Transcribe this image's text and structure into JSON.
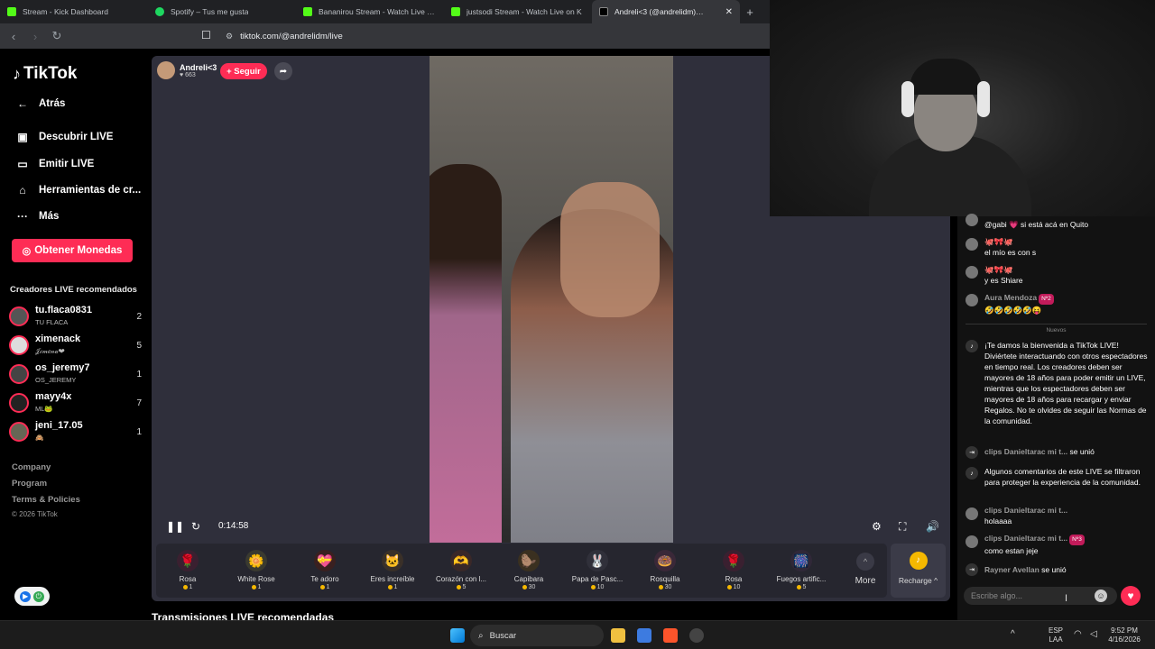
{
  "browser": {
    "tabs": [
      {
        "label": "Stream - Kick Dashboard",
        "color": "#53fc18"
      },
      {
        "label": "Spotify – Tus me gusta",
        "color": "#1ed760"
      },
      {
        "label": "Bananirou Stream - Watch Live on Ki",
        "color": "#53fc18"
      },
      {
        "label": "justsodi Stream - Watch Live on K",
        "color": "#53fc18"
      },
      {
        "label": "Andreli<3 (@andrelidm) está",
        "color": "#ffffff"
      }
    ],
    "new_tab": "+",
    "url": "tiktok.com/@andrelidm/live"
  },
  "sidebar": {
    "logo": "TikTok",
    "back": "Atrás",
    "menu": [
      {
        "label": "Descubrir LIVE",
        "icon": "discover-live-icon"
      },
      {
        "label": "Emitir LIVE",
        "icon": "camera-icon"
      },
      {
        "label": "Herramientas de cr...",
        "icon": "creator-tools-icon"
      },
      {
        "label": "Más",
        "icon": "more-dots-icon"
      }
    ],
    "coins_button": "Obtener Monedas",
    "section_title": "Creadores LIVE recomendados",
    "creators": [
      {
        "name": "tu.flaca0831",
        "sub": "TU FLACA",
        "count": "2"
      },
      {
        "name": "ximenack",
        "sub": "𝒥𝒾𝓂𝑒𝓃𝒶❤",
        "count": "5"
      },
      {
        "name": "os_jeremy7",
        "sub": "OS_JEREMY",
        "count": "1"
      },
      {
        "name": "mayy4x",
        "sub": "ML🐸",
        "count": "7"
      },
      {
        "name": "jeni_17.05",
        "sub": "🙈",
        "count": "1"
      }
    ],
    "footer": [
      "Company",
      "Program",
      "Terms & Policies"
    ],
    "copyright": "© 2026 TikTok"
  },
  "player": {
    "host_name": "Andreli<3",
    "host_likes": "♥ 663",
    "follow": "+ Seguir",
    "time": "0:14:58",
    "gifts": [
      {
        "name": "Rosa",
        "price": "1",
        "icon": "🌹",
        "bg": "#3a2030"
      },
      {
        "name": "White Rose",
        "price": "1",
        "icon": "🌼",
        "bg": "#3a3a30"
      },
      {
        "name": "Te adoro",
        "price": "1",
        "icon": "💝",
        "bg": "#3a2020"
      },
      {
        "name": "Eres increíble",
        "price": "1",
        "icon": "🐱",
        "bg": "#3a3028"
      },
      {
        "name": "Corazón con l...",
        "price": "5",
        "icon": "🫶",
        "bg": "#3a2828"
      },
      {
        "name": "Capibara",
        "price": "30",
        "icon": "🦫",
        "bg": "#3a3020"
      },
      {
        "name": "Papa de Pasc...",
        "price": "10",
        "icon": "🐰",
        "bg": "#30303a"
      },
      {
        "name": "Rosquilla",
        "price": "30",
        "icon": "🍩",
        "bg": "#3a2838"
      },
      {
        "name": "Rosa",
        "price": "10",
        "icon": "🌹",
        "bg": "#3a2030"
      },
      {
        "name": "Fuegos artific...",
        "price": "5",
        "icon": "🎆",
        "bg": "#302838"
      }
    ],
    "more": "More",
    "recharge": "Recharge ^",
    "recommended": "Transmisiones LIVE recomendadas"
  },
  "chat": {
    "messages": [
      {
        "user": "",
        "badge": "",
        "text": "@gabi 💗 si está acá en Quito"
      },
      {
        "user": "🐙🎀🐙",
        "badge": "",
        "text": "el mío es con s"
      },
      {
        "user": "🐙🎀🐙",
        "badge": "",
        "text": "y es Shiare"
      },
      {
        "user": "Aura Mendoza",
        "badge": "Nº2",
        "text": "🤣🤣🤣🤣🤣😝"
      },
      {
        "user": "",
        "badge": "",
        "text": "¡Te damos la bienvenida a TikTok LIVE! Diviértete interactuando con otros espectadores en tiempo real. Los creadores deben ser mayores de 18 años para poder emitir un LIVE, mientras que los espectadores deben ser mayores de 18 años para recargar y enviar Regalos. No te olvides de seguir las Normas de la comunidad."
      },
      {
        "user": "clips Danieltarac mi t...",
        "badge": "",
        "text": "se unió"
      },
      {
        "user": "",
        "badge": "",
        "text": "Algunos comentarios de este LIVE se filtraron para proteger la experiencia de la comunidad."
      },
      {
        "user": "clips Danieltarac mi t...",
        "badge": "",
        "text": "holaaaa"
      },
      {
        "user": "clips Danieltarac mi t...",
        "badge": "Nº3",
        "text": "como estan jeje"
      },
      {
        "user": "Rayner Avellan",
        "badge": "",
        "text": "se unió"
      }
    ],
    "divider": "Nuevos",
    "input_placeholder": "Escribe algo..."
  },
  "taskbar": {
    "search": "Buscar",
    "lang": "ESP",
    "lang2": "LAA",
    "clock": "9:52 PM",
    "date": "4/16/2026"
  }
}
